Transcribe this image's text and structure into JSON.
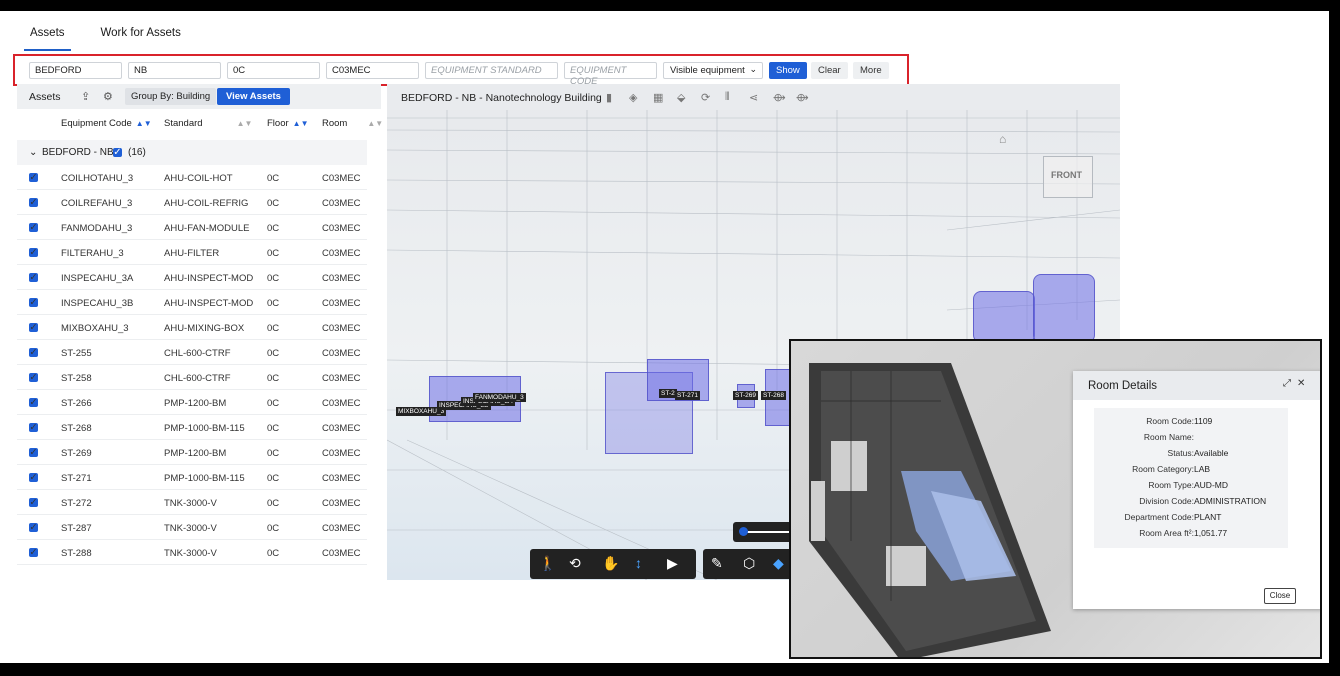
{
  "tabs": [
    {
      "label": "Assets"
    },
    {
      "label": "Work for Assets"
    }
  ],
  "filters": {
    "site": "BEDFORD",
    "building": "NB",
    "floor": "0C",
    "room": "C03MEC",
    "equipment_standard_placeholder": "EQUIPMENT STANDARD",
    "equipment_code_placeholder": "EQUIPMENT CODE",
    "visibility_selected": "Visible equipment",
    "show_label": "Show",
    "clear_label": "Clear",
    "more_label": "More"
  },
  "assets_panel": {
    "title": "Assets",
    "group_by_label": "Group By: Building",
    "view_assets_label": "View Assets",
    "columns": [
      "Equipment Code",
      "Standard",
      "Floor",
      "Room"
    ],
    "group": {
      "label": "BEDFORD - NB",
      "count": "(16)"
    },
    "rows": [
      {
        "code": "COILHOTAHU_3",
        "standard": "AHU-COIL-HOT",
        "floor": "0C",
        "room": "C03MEC"
      },
      {
        "code": "COILREFAHU_3",
        "standard": "AHU-COIL-REFRIG",
        "floor": "0C",
        "room": "C03MEC"
      },
      {
        "code": "FANMODAHU_3",
        "standard": "AHU-FAN-MODULE",
        "floor": "0C",
        "room": "C03MEC"
      },
      {
        "code": "FILTERAHU_3",
        "standard": "AHU-FILTER",
        "floor": "0C",
        "room": "C03MEC"
      },
      {
        "code": "INSPECAHU_3A",
        "standard": "AHU-INSPECT-MOD",
        "floor": "0C",
        "room": "C03MEC"
      },
      {
        "code": "INSPECAHU_3B",
        "standard": "AHU-INSPECT-MOD",
        "floor": "0C",
        "room": "C03MEC"
      },
      {
        "code": "MIXBOXAHU_3",
        "standard": "AHU-MIXING-BOX",
        "floor": "0C",
        "room": "C03MEC"
      },
      {
        "code": "ST-255",
        "standard": "CHL-600-CTRF",
        "floor": "0C",
        "room": "C03MEC"
      },
      {
        "code": "ST-258",
        "standard": "CHL-600-CTRF",
        "floor": "0C",
        "room": "C03MEC"
      },
      {
        "code": "ST-266",
        "standard": "PMP-1200-BM",
        "floor": "0C",
        "room": "C03MEC"
      },
      {
        "code": "ST-268",
        "standard": "PMP-1000-BM-115",
        "floor": "0C",
        "room": "C03MEC"
      },
      {
        "code": "ST-269",
        "standard": "PMP-1200-BM",
        "floor": "0C",
        "room": "C03MEC"
      },
      {
        "code": "ST-271",
        "standard": "PMP-1000-BM-115",
        "floor": "0C",
        "room": "C03MEC"
      },
      {
        "code": "ST-272",
        "standard": "TNK-3000-V",
        "floor": "0C",
        "room": "C03MEC"
      },
      {
        "code": "ST-287",
        "standard": "TNK-3000-V",
        "floor": "0C",
        "room": "C03MEC"
      },
      {
        "code": "ST-288",
        "standard": "TNK-3000-V",
        "floor": "0C",
        "room": "C03MEC"
      }
    ]
  },
  "viewer": {
    "title": "BEDFORD - NB - Nanotechnology Building",
    "viewcube_label": "FRONT",
    "labels": {
      "mixbox": "MIXBOXAHU_3",
      "inspec3b": "INSPECAHU_3B",
      "inspec3a": "INSPECAHU_3A",
      "fanmod": "FANMODAHU_3",
      "st255": "ST-2",
      "st271": "ST-271",
      "st269": "ST-269",
      "st268": "ST-268"
    }
  },
  "room_details": {
    "title": "Room Details",
    "fields": [
      {
        "key": "Room Code:",
        "value": "1109"
      },
      {
        "key": "Room Name:",
        "value": ""
      },
      {
        "key": "Status:",
        "value": "Available"
      },
      {
        "key": "Room Category:",
        "value": "LAB"
      },
      {
        "key": "Room Type:",
        "value": "AUD-MD"
      },
      {
        "key": "Division Code:",
        "value": "ADMINISTRATION"
      },
      {
        "key": "Department Code:",
        "value": "PLANT"
      },
      {
        "key": "Room Area ft²:",
        "value": "1,051.77"
      }
    ],
    "close_label": "Close"
  },
  "colors": {
    "accent": "#1f5fd6",
    "highlight_border": "#d9232b",
    "equipment_highlight": "#6e6ee6"
  }
}
